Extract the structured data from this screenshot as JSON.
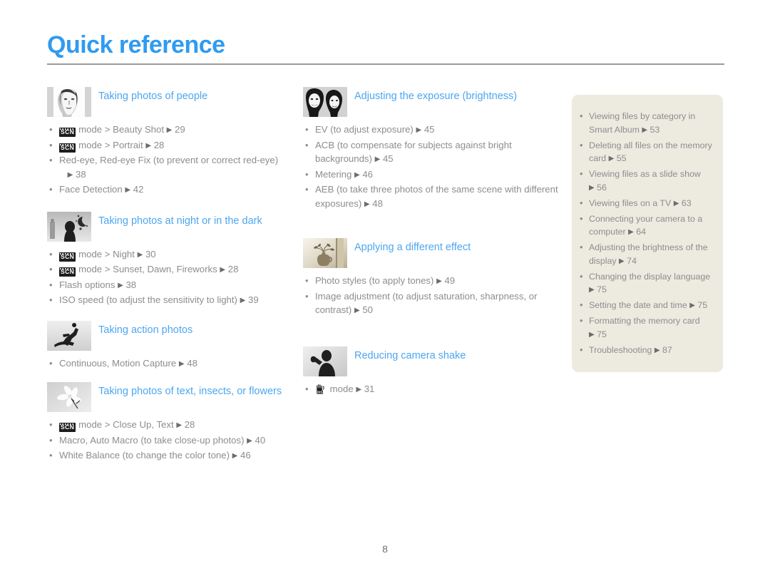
{
  "page": {
    "title": "Quick reference",
    "number": "8",
    "accent_blue": "#4da6f0",
    "title_blue": "#2f9bf0",
    "body_gray": "#8d8d8d",
    "panel_bg": "#edeae0"
  },
  "left_column": [
    {
      "thumb_name": "portrait-woman-thumbnail",
      "title": "Taking photos of people",
      "items": [
        {
          "icon": "scn",
          "icon_label": "SCN",
          "text": "mode > Beauty Shot",
          "page": "29"
        },
        {
          "icon": "scn",
          "icon_label": "SCN",
          "text": "mode > Portrait",
          "page": "28"
        },
        {
          "icon": null,
          "text": "Red-eye, Red-eye Fix (to prevent or correct red-eye)",
          "page": "38",
          "page_on_new_line": true
        },
        {
          "icon": null,
          "text": "Face Detection",
          "page": "42"
        }
      ]
    },
    {
      "thumb_name": "night-scene-thumbnail",
      "title": "Taking photos at night or in the dark",
      "items": [
        {
          "icon": "scn",
          "icon_label": "SCN",
          "text": "mode > Night",
          "page": "30"
        },
        {
          "icon": "scn",
          "icon_label": "SCN",
          "text": "mode > Sunset, Dawn, Fireworks",
          "page": "28"
        },
        {
          "icon": null,
          "text": "Flash options",
          "page": "38"
        },
        {
          "icon": null,
          "text": "ISO speed (to adjust the sensitivity to light)",
          "page": "39"
        }
      ]
    },
    {
      "thumb_name": "snowboarder-action-thumbnail",
      "title": "Taking action photos",
      "items": [
        {
          "icon": null,
          "text": "Continuous, Motion Capture",
          "page": "48"
        }
      ]
    },
    {
      "thumb_name": "flower-macro-thumbnail",
      "title": "Taking photos of text, insects, or flowers",
      "items": [
        {
          "icon": "scn",
          "icon_label": "SCN",
          "text": "mode > Close Up, Text",
          "page": "28"
        },
        {
          "icon": null,
          "text": "Macro, Auto Macro (to take close-up photos)",
          "page": "40"
        },
        {
          "icon": null,
          "text": "White Balance (to change the color tone)",
          "page": "46"
        }
      ]
    }
  ],
  "middle_column": [
    {
      "thumb_name": "two-faces-exposure-thumbnail",
      "title": "Adjusting the exposure (brightness)",
      "items": [
        {
          "icon": null,
          "text": "EV (to adjust exposure)",
          "page": "45"
        },
        {
          "icon": null,
          "text": "ACB (to compensate for subjects against bright backgrounds)",
          "page": "45"
        },
        {
          "icon": null,
          "text": "Metering",
          "page": "46"
        },
        {
          "icon": null,
          "text": "AEB (to take three photos of the same scene with different exposures)",
          "page": "48"
        }
      ]
    },
    {
      "thumb_name": "vase-sepia-effect-thumbnail",
      "title": "Applying a different effect",
      "items": [
        {
          "icon": null,
          "text": "Photo styles (to apply tones)",
          "page": "49"
        },
        {
          "icon": null,
          "text": "Image adjustment (to adjust saturation, sharpness, or contrast)",
          "page": "50"
        }
      ]
    },
    {
      "thumb_name": "camera-shake-person-thumbnail",
      "title": "Reducing camera shake",
      "items": [
        {
          "icon": "dis",
          "icon_label": "DIS",
          "text": "mode",
          "page": "31"
        }
      ]
    }
  ],
  "right_panel": {
    "items": [
      {
        "text": "Viewing files by category in Smart Album",
        "page": "53"
      },
      {
        "text": "Deleting all files on the memory card",
        "page": "55"
      },
      {
        "text": "Viewing files as a slide show",
        "page": "56"
      },
      {
        "text": "Viewing files on a TV",
        "page": "63"
      },
      {
        "text": "Connecting your camera to a computer",
        "page": "64"
      },
      {
        "text": "Adjusting the brightness of the display",
        "page": "74"
      },
      {
        "text": "Changing the display language",
        "page": "75"
      },
      {
        "text": "Setting the date and time",
        "page": "75"
      },
      {
        "text": "Formatting the memory card",
        "page": "75"
      },
      {
        "text": "Troubleshooting",
        "page": "87"
      }
    ]
  }
}
